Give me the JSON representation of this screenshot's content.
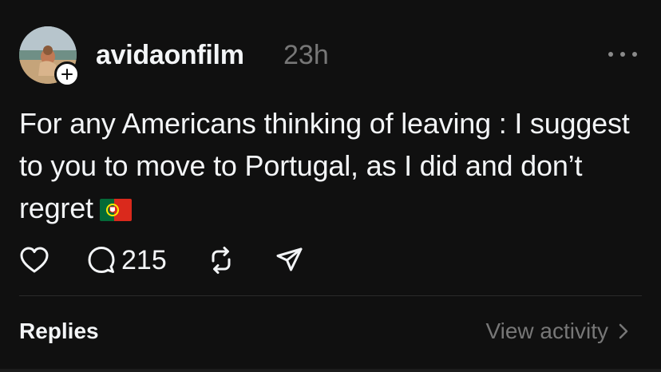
{
  "post": {
    "username": "avidaonfilm",
    "timestamp": "23h",
    "text": "For any Americans thinking of leaving : I suggest to you to move to Portugal, as I did and don’t regret",
    "flag_icon": "portugal-flag-icon",
    "replies_count": "215"
  },
  "footer": {
    "replies_label": "Replies",
    "view_activity_label": "View activity"
  },
  "colors": {
    "background": "#101010",
    "primary_text": "#f3f5f7",
    "secondary_text": "#777777",
    "divider": "#2b2b2b"
  }
}
